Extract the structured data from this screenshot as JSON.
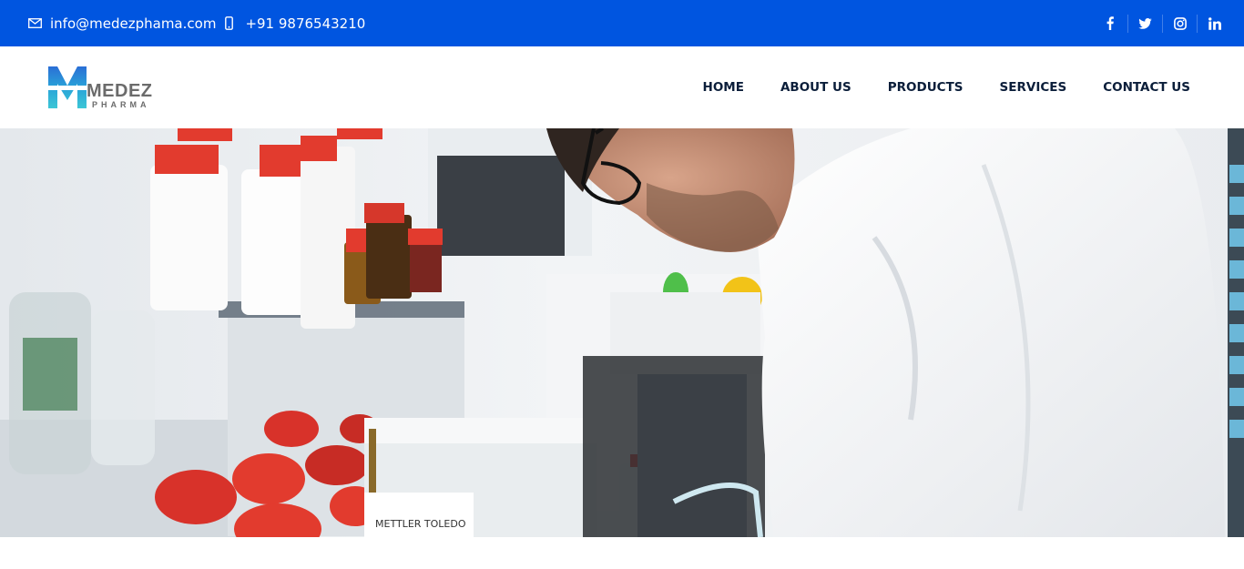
{
  "topbar": {
    "email": "info@medezphama.com",
    "phone": "+91 9876543210",
    "social": [
      {
        "name": "facebook-icon",
        "glyph": "f"
      },
      {
        "name": "twitter-icon",
        "glyph": "t"
      },
      {
        "name": "instagram-icon",
        "glyph": "ig"
      },
      {
        "name": "linkedin-icon",
        "glyph": "in"
      }
    ]
  },
  "brand": {
    "logo_letter": "M",
    "name": "MEDEZ",
    "tagline": "PHARMA"
  },
  "nav": {
    "items": [
      "HOME",
      "ABOUT US",
      "PRODUCTS",
      "SERVICES",
      "CONTACT US"
    ]
  },
  "hero": {
    "instrument_label": "METTLER TOLEDO"
  },
  "colors": {
    "topbar": "#0055e0",
    "nav_text": "#0b1e3a",
    "logo_teal": "#29b6d3",
    "logo_blue": "#2a6fd6",
    "bottle_cap": "#e23b2e"
  }
}
